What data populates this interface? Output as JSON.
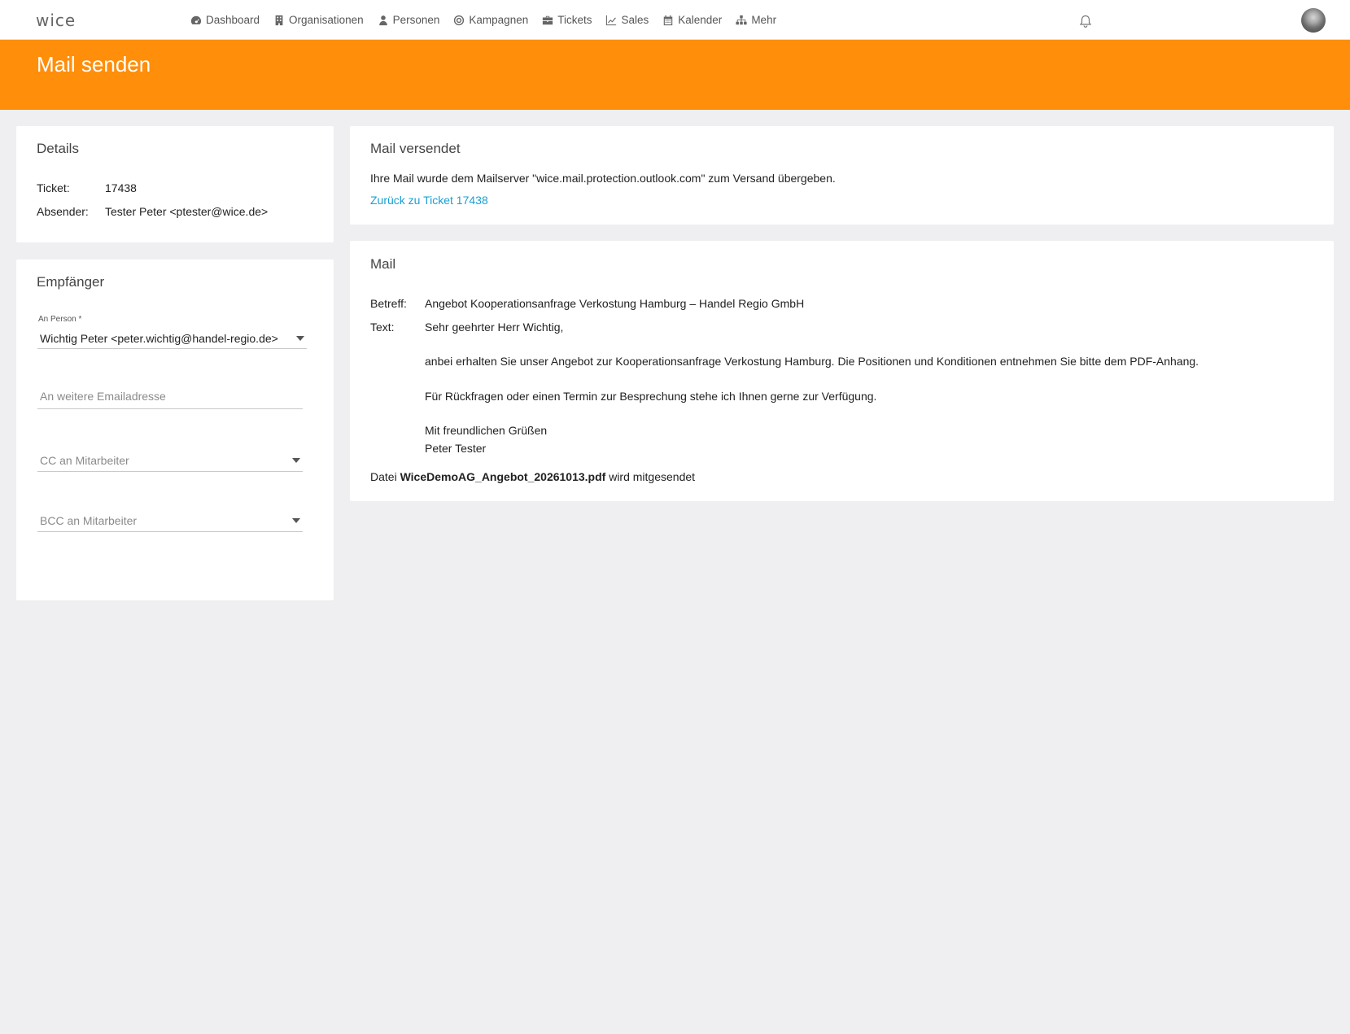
{
  "app": {
    "logo_text": "wice",
    "nav": [
      {
        "label": "Dashboard",
        "icon": "dashboard-icon"
      },
      {
        "label": "Organisationen",
        "icon": "building-icon"
      },
      {
        "label": "Personen",
        "icon": "person-icon"
      },
      {
        "label": "Kampagnen",
        "icon": "target-icon"
      },
      {
        "label": "Tickets",
        "icon": "briefcase-icon"
      },
      {
        "label": "Sales",
        "icon": "chart-line-icon"
      },
      {
        "label": "Kalender",
        "icon": "calendar-icon"
      },
      {
        "label": "Mehr",
        "icon": "sitemap-icon"
      }
    ],
    "accent_color": "#ff8e0b",
    "link_color": "#1a9fd4"
  },
  "page": {
    "title": "Mail senden"
  },
  "details": {
    "title": "Details",
    "ticket_label": "Ticket:",
    "ticket_value": "17438",
    "sender_label": "Absender:",
    "sender_value": "Tester Peter <ptester@wice.de>"
  },
  "recipients": {
    "title": "Empfänger",
    "to_person_label": "An Person *",
    "to_person_value": "Wichtig Peter <peter.wichtig@handel-regio.de>",
    "more_email_placeholder": "An weitere Emailadresse",
    "cc_placeholder": "CC an Mitarbeiter",
    "bcc_placeholder": "BCC an Mitarbeiter"
  },
  "sent": {
    "title": "Mail versendet",
    "message": "Ihre Mail wurde dem Mailserver \"wice.mail.protection.outlook.com\" zum Versand übergeben.",
    "back_link": "Zurück zu Ticket 17438"
  },
  "mail": {
    "title": "Mail",
    "subject_label": "Betreff:",
    "subject_value": "Angebot Kooperationsanfrage Verkostung Hamburg – Handel Regio GmbH",
    "text_label": "Text:",
    "body": {
      "greeting": "Sehr geehrter Herr Wichtig,",
      "para1": "anbei erhalten Sie unser Angebot zur Kooperationsanfrage Verkostung Hamburg. Die Positionen und Konditionen entnehmen Sie bitte dem PDF-Anhang.",
      "para2": "Für Rückfragen oder einen Termin zur Besprechung stehe ich Ihnen gerne zur Verfügung.",
      "closing": "Mit freundlichen Grüßen",
      "signature": "Peter Tester"
    },
    "attachment_prefix": "Datei",
    "attachment_name": "WiceDemoAG_Angebot_20261013.pdf",
    "attachment_suffix": "wird mitgesendet"
  }
}
